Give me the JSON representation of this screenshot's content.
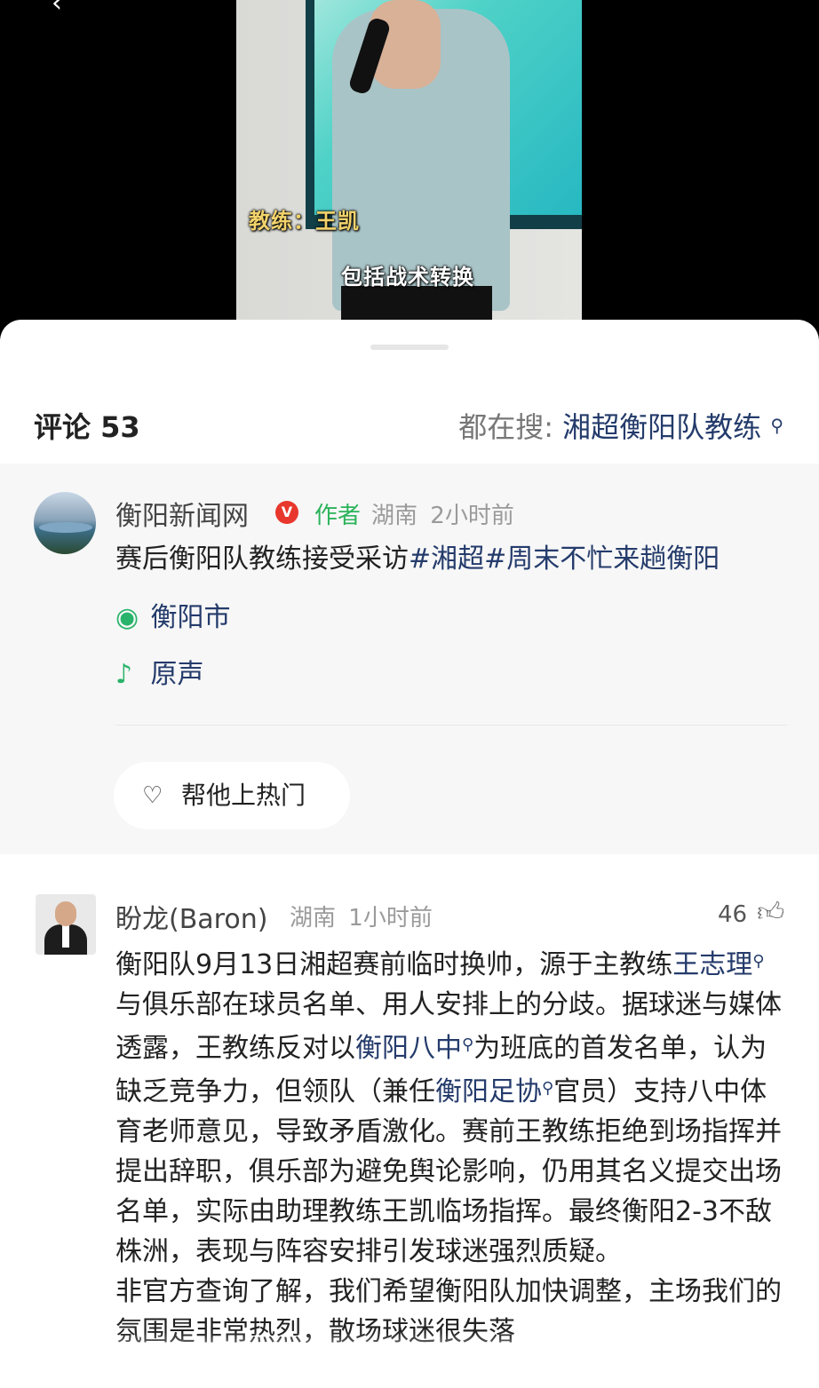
{
  "video": {
    "caption_name": "教练：王凯",
    "caption_line": "包括战术转换",
    "back_glyph": "‹"
  },
  "comments_header": {
    "title": "评论 53",
    "search_prefix": "都在搜:",
    "search_term": "湘超衡阳队教练",
    "search_icon": "search-icon"
  },
  "author_post": {
    "name": "衡阳新闻网",
    "verified_mark": "V",
    "tag": "作者",
    "region": "湖南",
    "time": "2小时前",
    "text_plain": "赛后衡阳队教练接受采访",
    "hashtag_1": "#湘超",
    "hashtag_2": "#周末不忙来趟衡阳",
    "location": "衡阳市",
    "location_icon": "location-pin-icon",
    "sound": "原声",
    "sound_icon": "music-note-icon",
    "boost_label": "帮他上热门",
    "boost_icon": "heart-icon"
  },
  "reply": {
    "name": "盼龙(Baron)",
    "region": "湖南",
    "time": "1小时前",
    "likes": "46",
    "like_icon": "thumbs-up-icon",
    "p1_a": "衡阳队9月13日湘超赛前临时换帅，源于主教练",
    "p1_kw1": "王志理",
    "p1_b": "与俱乐部在球员名单、用人安排上的分歧。据球迷与媒体透露，王教练反对以",
    "p1_kw2": "衡阳八中",
    "p1_c": "为班底的首发名单，认为缺乏竞争力，但领队（兼任",
    "p1_kw3": "衡阳足协",
    "p1_d": "官员）支持八中体育老师意见，导致矛盾激化。赛前王教练拒绝到场指挥并提出辞职，俱乐部为避免舆论影响，仍用其名义提交出场名单，实际由助理教练王凯临场指挥。最终衡阳2-3不敌株洲，表现与阵容安排引发球迷强烈质疑。",
    "p2": "非官方查询了解，我们希望衡阳队加快调整，主场我们的氛围是非常热烈，散场球迷很失落"
  }
}
